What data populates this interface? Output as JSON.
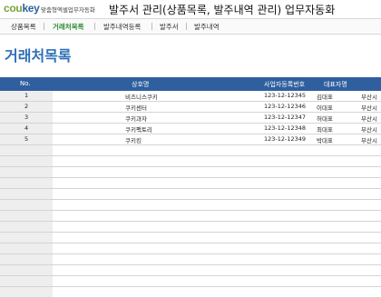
{
  "header": {
    "logo_primary": "cou",
    "logo_secondary": "key",
    "logo_tagline": "맞춤형엑셀업무자동화",
    "title": "발주서 관리(상품목록, 발주내역 관리) 업무자동화"
  },
  "nav": {
    "items": [
      {
        "label": "상품목록",
        "active": false
      },
      {
        "label": "거래처목록",
        "active": true
      },
      {
        "label": "발주내역등록",
        "active": false
      },
      {
        "label": "발주서",
        "active": false
      },
      {
        "label": "발주내역",
        "active": false
      }
    ]
  },
  "page": {
    "title": "거래처목록"
  },
  "table": {
    "columns": [
      "No.",
      "상호명",
      "사업자등록번호",
      "대표자명"
    ],
    "rows": [
      {
        "no": "1",
        "name": "비즈니스쿠키",
        "biz_no": "123-12-12345",
        "rep": "김대표",
        "extra": "부산시"
      },
      {
        "no": "2",
        "name": "쿠키센터",
        "biz_no": "123-12-12346",
        "rep": "이대표",
        "extra": "부산시"
      },
      {
        "no": "3",
        "name": "쿠키과자",
        "biz_no": "123-12-12347",
        "rep": "허대표",
        "extra": "부산시"
      },
      {
        "no": "4",
        "name": "쿠키팩토리",
        "biz_no": "123-12-12348",
        "rep": "최대표",
        "extra": "부산시"
      },
      {
        "no": "5",
        "name": "쿠키킹",
        "biz_no": "123-12-12349",
        "rep": "박대표",
        "extra": "부산시"
      }
    ],
    "empty_rows": 14
  },
  "colors": {
    "accent": "#2f6fb8",
    "header_bg": "#2f5f9e",
    "nav_active": "#2e8b34",
    "logo_green": "#7aa23a"
  }
}
